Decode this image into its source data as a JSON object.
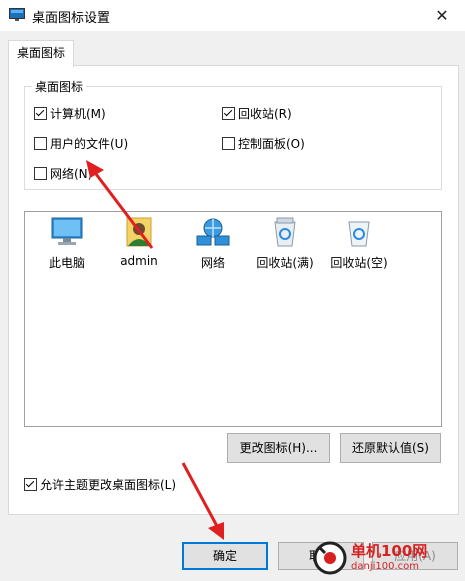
{
  "window": {
    "title": "桌面图标设置",
    "close_glyph": "✕"
  },
  "tab": {
    "label": "桌面图标"
  },
  "group": {
    "label": "桌面图标",
    "checkboxes": [
      {
        "label": "计算机(M)",
        "checked": true
      },
      {
        "label": "回收站(R)",
        "checked": true
      },
      {
        "label": "用户的文件(U)",
        "checked": false
      },
      {
        "label": "控制面板(O)",
        "checked": false
      },
      {
        "label": "网络(N)",
        "checked": false
      }
    ]
  },
  "icons": [
    {
      "label": "此电脑",
      "icon": "computer-icon"
    },
    {
      "label": "admin",
      "icon": "user-folder-icon"
    },
    {
      "label": "网络",
      "icon": "network-icon"
    },
    {
      "label": "回收站(满)",
      "icon": "recycle-bin-full-icon"
    },
    {
      "label": "回收站(空)",
      "icon": "recycle-bin-empty-icon"
    }
  ],
  "buttons": {
    "change_icon": "更改图标(H)...",
    "restore_default": "还原默认值(S)",
    "ok": "确定",
    "cancel": "取消",
    "apply": "应用(A)"
  },
  "allow_themes": {
    "label": "允许主题更改桌面图标(L)",
    "checked": true
  },
  "watermark": {
    "brand": "单机100网",
    "url": "danji100.com"
  },
  "colors": {
    "accent": "#0078d7",
    "arrow": "#e02020"
  }
}
